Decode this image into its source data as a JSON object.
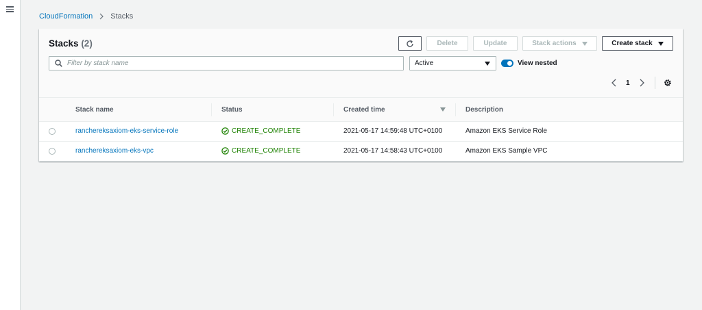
{
  "breadcrumb": {
    "root": "CloudFormation",
    "current": "Stacks"
  },
  "header": {
    "title": "Stacks",
    "count": "(2)"
  },
  "toolbar": {
    "delete_label": "Delete",
    "update_label": "Update",
    "stack_actions_label": "Stack actions",
    "create_stack_label": "Create stack"
  },
  "filter": {
    "placeholder": "Filter by stack name",
    "status_selected": "Active",
    "view_nested_label": "View nested"
  },
  "pagination": {
    "current_page": "1"
  },
  "table": {
    "columns": [
      "Stack name",
      "Status",
      "Created time",
      "Description"
    ],
    "rows": [
      {
        "name": "ranchereksaxiom-eks-service-role",
        "status": "CREATE_COMPLETE",
        "created": "2021-05-17 14:59:48 UTC+0100",
        "description": "Amazon EKS Service Role"
      },
      {
        "name": "ranchereksaxiom-eks-vpc",
        "status": "CREATE_COMPLETE",
        "created": "2021-05-17 14:58:43 UTC+0100",
        "description": "Amazon EKS Sample VPC"
      }
    ]
  },
  "colors": {
    "link": "#0073bb",
    "success": "#1d8102",
    "accent": "#0073bb"
  }
}
